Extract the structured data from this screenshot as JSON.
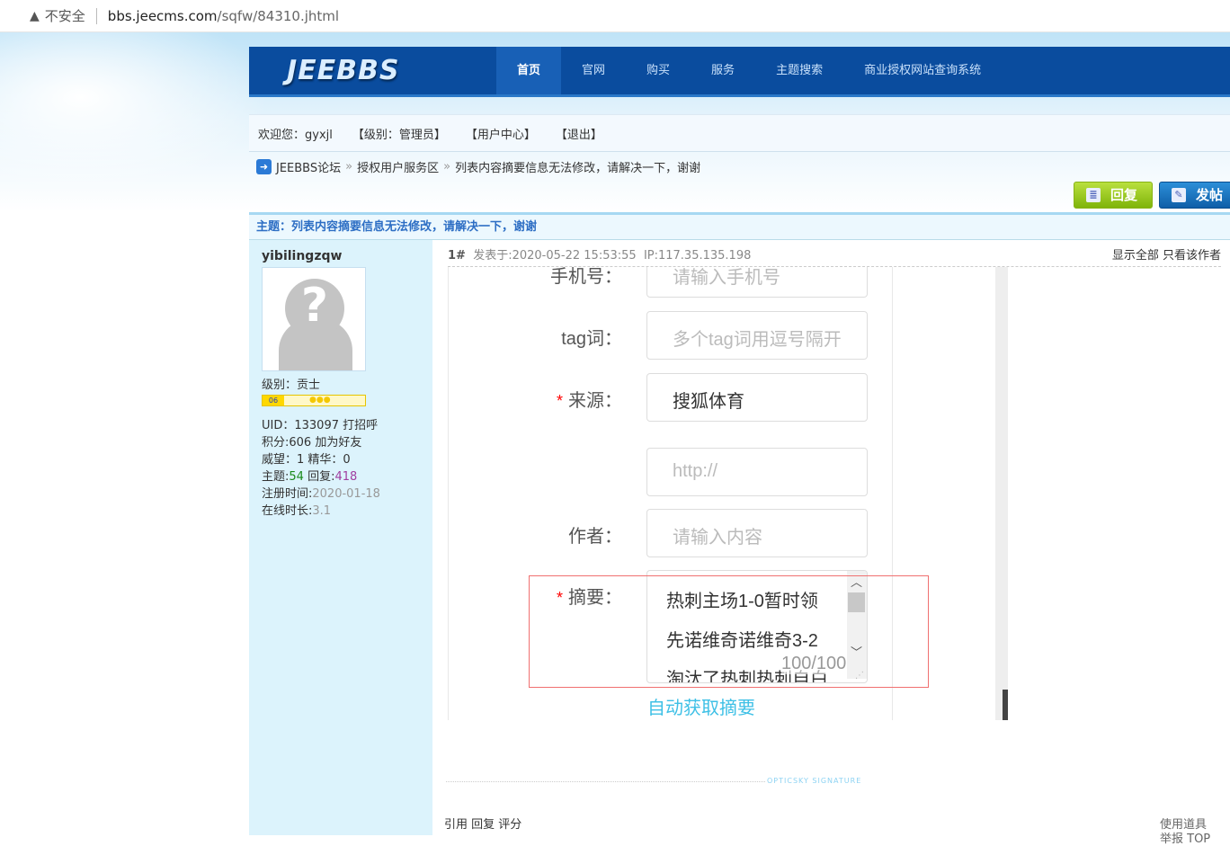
{
  "browser": {
    "security": "不安全",
    "url_host": "bbs.jeecms.com",
    "url_path": "/sqfw/84310.jhtml"
  },
  "header": {
    "logo": "JEEBBS",
    "nav": [
      "首页",
      "官网",
      "购买",
      "服务",
      "主题搜索",
      "商业授权网站查询系统"
    ]
  },
  "welcome": {
    "greeting": "欢迎您：gyxjl",
    "level": "【级别：管理员】",
    "user_center": "【用户中心】",
    "logout": "【退出】"
  },
  "breadcrumb": {
    "items": [
      "JEEBBS论坛",
      "授权用户服务区",
      "列表内容摘要信息无法修改，请解决一下，谢谢"
    ],
    "sep": "»"
  },
  "actions": {
    "reply": "回复",
    "post": "发帖"
  },
  "topic": {
    "title": "主题：列表内容摘要信息无法修改，请解决一下，谢谢"
  },
  "author": {
    "name": "yibilingzqw",
    "level": "级别：贡士",
    "level_badge": "06",
    "uid": "UID：133097",
    "greet": "打招呼",
    "points": "积分:606",
    "add_friend": "加为好友",
    "prestige": "威望：1 精华：0",
    "topics_label": "主题:",
    "topics": "54",
    "replies_label": " 回复:",
    "replies": "418",
    "reg_label": "注册时间:",
    "reg": "2020-01-18",
    "online_label": "在线时长:",
    "online": "3.1"
  },
  "post": {
    "floor": "1#",
    "posted": "发表于:2020-05-22 15:53:55",
    "ip": "IP:117.35.135.198",
    "show_all": "显示全部",
    "only_author": "只看该作者"
  },
  "screenshot": {
    "fields": [
      {
        "label": "手机号：",
        "placeholder": "请输入手机号"
      },
      {
        "label": "tag词：",
        "placeholder": "多个tag词用逗号隔开"
      },
      {
        "label": "来源：",
        "required": "*",
        "value": "搜狐体育"
      },
      {
        "label": "",
        "placeholder": "http://"
      },
      {
        "label": "作者：",
        "placeholder": "请输入内容"
      }
    ],
    "summary": {
      "required": "*",
      "label": "摘要：",
      "lines": [
        "热刺主场1-0暂时领",
        "先诺维奇诺维奇3-2",
        "淘汰了热刺热刺自白"
      ],
      "count": "100/100"
    },
    "auto_summary": "自动获取摘要"
  },
  "signature": "OPTICSKY SIGNATURE",
  "footer": {
    "actions": "引用 回复 评分",
    "tools": "使用道具",
    "tools2": "举报  TOP"
  }
}
